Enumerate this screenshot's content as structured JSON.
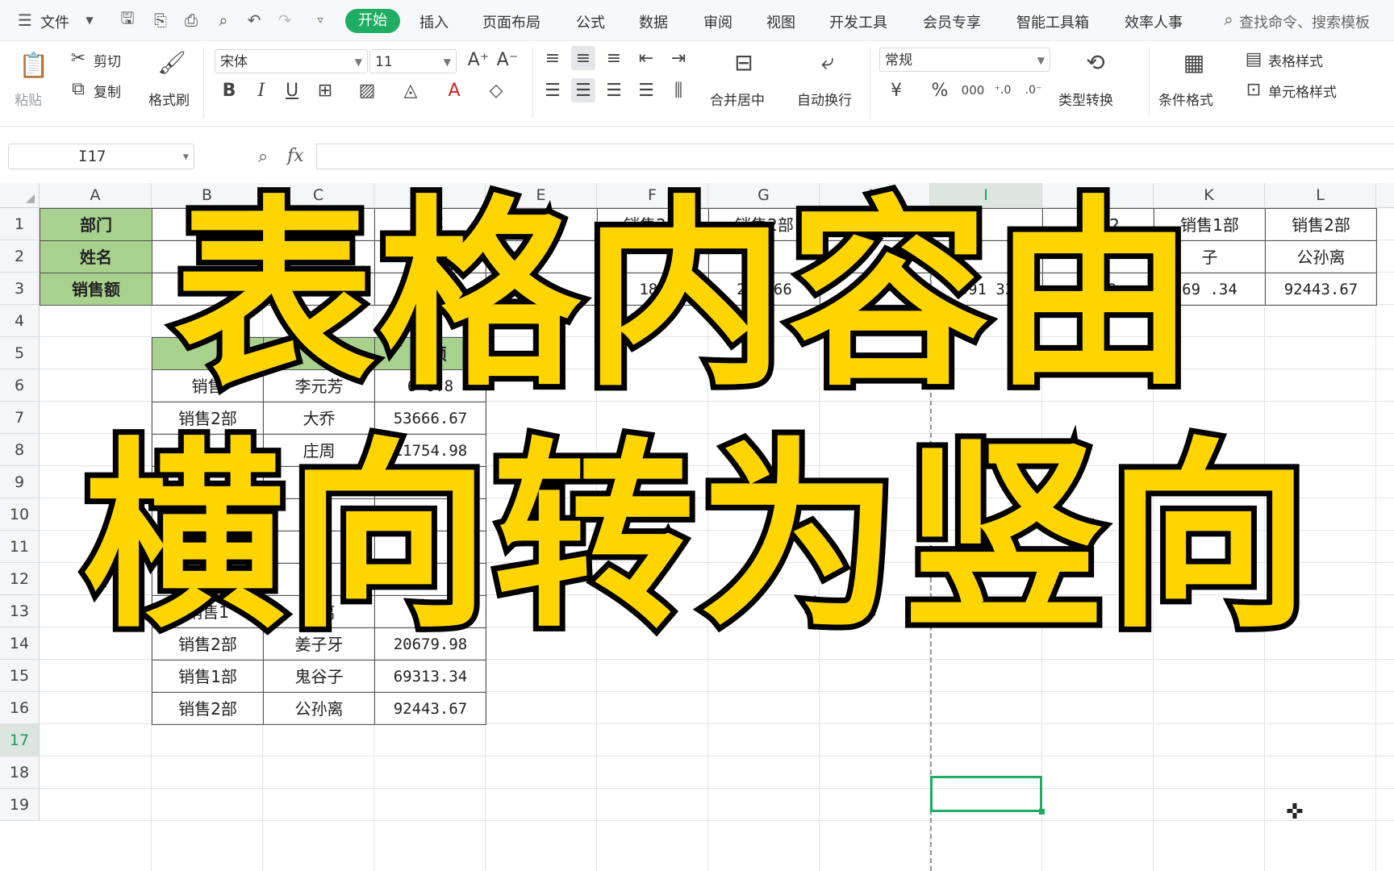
{
  "menubar": {
    "file": "文件",
    "tabs": [
      "开始",
      "插入",
      "页面布局",
      "公式",
      "数据",
      "审阅",
      "视图",
      "开发工具",
      "会员专享",
      "智能工具箱",
      "效率人事"
    ],
    "active_tab": "开始",
    "search_placeholder": "查找命令、搜索模板"
  },
  "ribbon": {
    "paste": "粘贴",
    "cut": "剪切",
    "copy": "复制",
    "format_painter": "格式刷",
    "font_name": "宋体",
    "font_size": "11",
    "bold": "B",
    "italic": "I",
    "underline": "U",
    "merge_center": "合并居中",
    "wrap_text": "自动换行",
    "number_format": "常规",
    "currency": "¥",
    "percent": "%",
    "thousands": "000",
    "type_convert": "类型转换",
    "conditional_format": "条件格式",
    "table_style": "表格样式",
    "cell_style": "单元格样式"
  },
  "formula_bar": {
    "name_box": "I17",
    "fx": "fx",
    "value": ""
  },
  "sheet": {
    "columns": [
      "A",
      "B",
      "C",
      "D",
      "E",
      "F",
      "G",
      "H",
      "I",
      "J",
      "K",
      "L"
    ],
    "rows": [
      "1",
      "2",
      "3",
      "4",
      "5",
      "6",
      "7",
      "8",
      "9",
      "10",
      "11",
      "12",
      "13",
      "14",
      "15",
      "16",
      "17",
      "18",
      "19"
    ],
    "selected_column": "I",
    "selected_row": "17",
    "row_labels": {
      "r1": "部门",
      "r2": "姓名",
      "r3": "销售额"
    },
    "horizontal_visible": {
      "D1": "1部",
      "F1": "销售2部",
      "G1": "销售2部",
      "J1": "销售2",
      "K1": "销售1部",
      "L1": "销售2部",
      "K2": "子",
      "L2": "公孙离",
      "F3": "18.",
      "G3": "281 66",
      "I3": "591 33",
      "J3": "0679",
      "K3": "69 .34",
      "L3": "92443.67"
    },
    "vertical_visible": {
      "D5": "售额",
      "B6": "销售",
      "C6": "李元芳",
      "D6": "6 0.8",
      "B7": "销售2部",
      "C7": "大乔",
      "D7": "53666.67",
      "C8": "庄周",
      "D8": "11754.98",
      "D9": "3",
      "D10": "7",
      "D11": "6",
      "D12": "1",
      "B13": "销售1",
      "C13": "靳离",
      "D13": "5 3",
      "B14": "销售2部",
      "C14": "姜子牙",
      "D14": "20679.98",
      "B15": "销售1部",
      "C15": "鬼谷子",
      "D15": "69313.34",
      "B16": "销售2部",
      "C16": "公孙离",
      "D16": "92443.67"
    }
  },
  "overlay": {
    "line1": "表格内容由",
    "line2": "横向转为竖向"
  },
  "colors": {
    "accent": "#1ead63",
    "header_fill": "#a9d18e",
    "caption_fill": "#ffd500",
    "caption_stroke": "#000000"
  }
}
